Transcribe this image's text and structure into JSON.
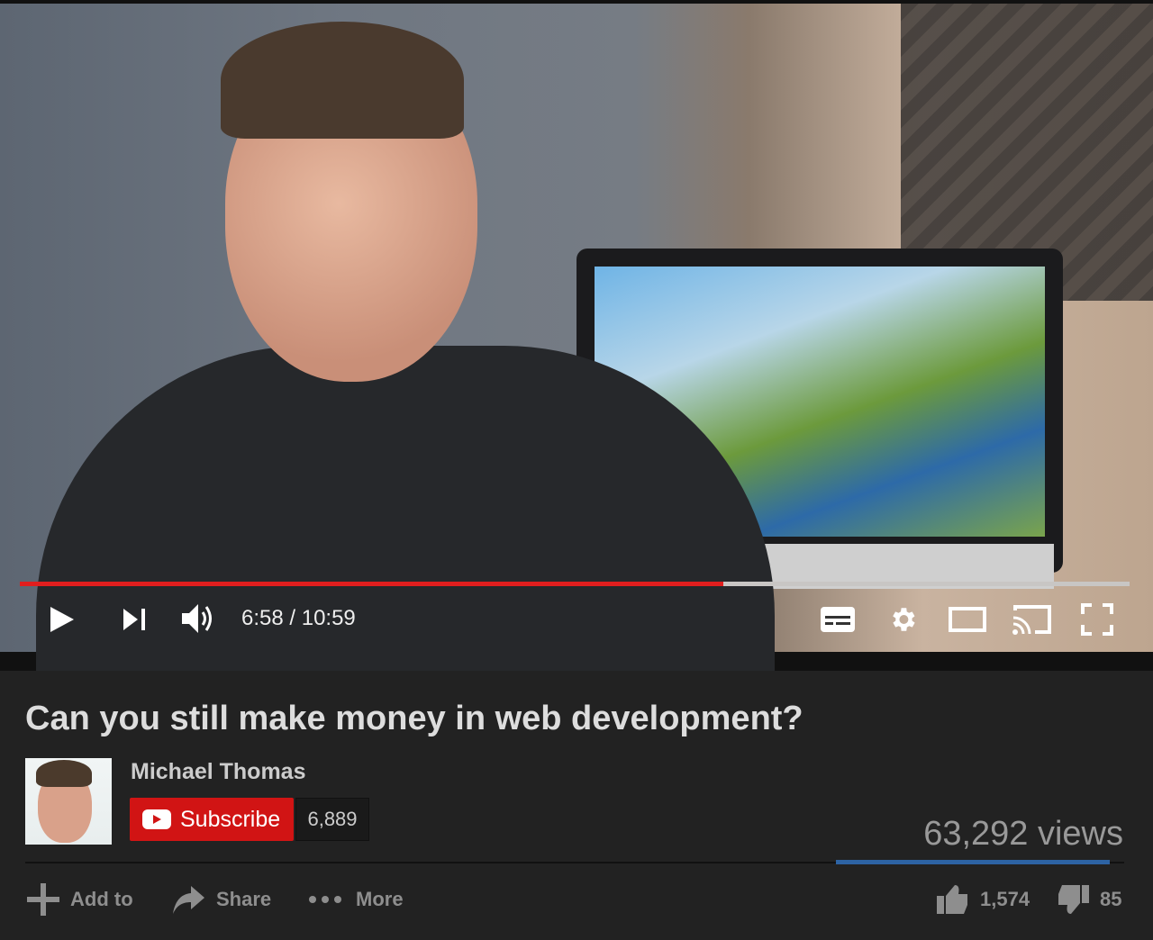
{
  "player": {
    "current_time": "6:58",
    "duration": "10:59",
    "time_display": "6:58 / 10:59",
    "progress_fraction": 0.634
  },
  "video": {
    "title": "Can you still make money in web development?",
    "views": "63,292 views",
    "likes": "1,574",
    "dislikes": "85",
    "like_ratio": 0.95
  },
  "channel": {
    "name": "Michael Thomas",
    "subscribe_label": "Subscribe",
    "subscriber_count": "6,889"
  },
  "actions": {
    "add_to": "Add to",
    "share": "Share",
    "more": "More"
  },
  "colors": {
    "progress": "#e01e1e",
    "subscribe": "#d11414",
    "sentiment": "#2d63a3"
  }
}
